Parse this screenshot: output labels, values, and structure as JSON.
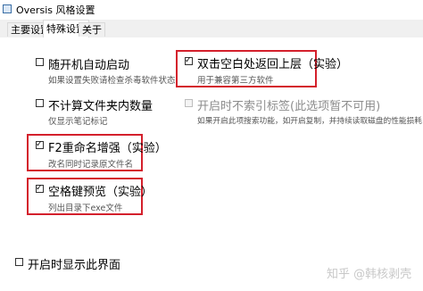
{
  "window": {
    "title": "Oversis 风格设置"
  },
  "tabs": [
    {
      "label": "主要设置",
      "active": false
    },
    {
      "label": "特殊设置",
      "active": true
    },
    {
      "label": "关于",
      "active": false
    }
  ],
  "options": {
    "auto_start": {
      "label": "随开机自动启动",
      "desc": "如果设置失败请检查杀毒软件状态",
      "checked": false
    },
    "no_count": {
      "label": "不计算文件夹内数量",
      "desc": "仅显示笔记标记",
      "checked": false
    },
    "f2_rename": {
      "label": "F2重命名增强（实验）",
      "desc": "改名同时记录原文件名",
      "checked": true
    },
    "space_preview": {
      "label": "空格键预览（实验）",
      "desc": "列出目录下exe文件",
      "checked": true
    },
    "dbl_click_up": {
      "label": "双击空白处返回上层（实验）",
      "desc": "用于兼容第三方软件",
      "checked": true
    },
    "no_index_tags": {
      "label": "开启时不索引标签(此选项暂不可用)",
      "desc": "如果开启此项搜索功能，如开启复制，并持续读取磁盘的性能损耗",
      "checked": false,
      "disabled": true
    },
    "show_on_start": {
      "label": "开启时显示此界面",
      "checked": false
    }
  },
  "watermark": "知乎 @韩核剥壳",
  "colors": {
    "highlight": "#d4202c"
  }
}
